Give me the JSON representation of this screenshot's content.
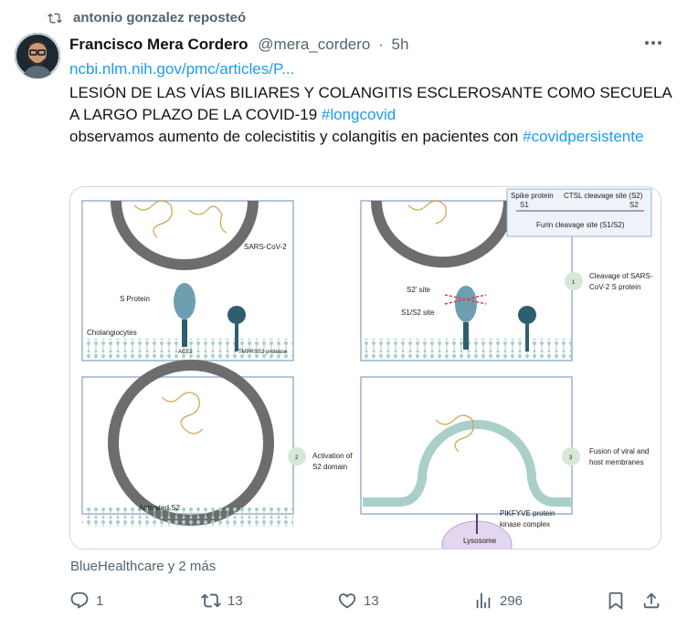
{
  "repost": {
    "icon": "repost-icon",
    "text": "antonio gonzalez reposteó"
  },
  "post": {
    "author_name": "Francisco Mera Cordero",
    "author_handle": "@mera_cordero",
    "separator": "·",
    "time": "5h",
    "link_text": "ncbi.nlm.nih.gov/pmc/articles/P...",
    "line1_text": "LESIÓN DE LAS VÍAS BILIARES Y COLANGITIS ESCLEROSANTE COMO SECUELA A LARGO PLAZO DE LA COVID-19 ",
    "line1_hashtag": "#longcovid",
    "line2_text": "observamos aumento de colecistitis y colangitis en pacientes con ",
    "line2_hashtag": "#covidpersistente"
  },
  "figure": {
    "sars_label": "SARS-CoV-2",
    "s_protein": "S Protein",
    "cholangiocytes": "Cholangiocytes",
    "ace2": "ACE2",
    "tmprss2": "TMPRSS2 protease",
    "spike_box": {
      "spike_protein": "Spike protein",
      "s1": "S1",
      "ctsl": "CTSL cleavage site (S2)",
      "s2": "S2",
      "furin": "Furin cleavage site (S1/S2)"
    },
    "s2_site": "S2' site",
    "s1s2_site": "S1/S2 site",
    "step1_num": "1",
    "step1": "Cleavage of SARS-CoV-2 S protein",
    "step2_num": "2",
    "step2": "Activation of S2 domain",
    "activated_s2": "Activated S2",
    "step3_num": "3",
    "step3": "Fusion of viral and host membranes",
    "pikfyve": "PIKFYVE protein kinase complex",
    "lysosome": "Lysosome"
  },
  "context": "BlueHealthcare y 2 más",
  "actions": {
    "reply": {
      "icon": "reply-icon",
      "count": "1"
    },
    "repost": {
      "icon": "repost-icon",
      "count": "13"
    },
    "like": {
      "icon": "heart-icon",
      "count": "13"
    },
    "views": {
      "icon": "views-icon",
      "count": "296"
    },
    "bookmark": {
      "icon": "bookmark-icon"
    },
    "share": {
      "icon": "share-icon"
    }
  },
  "colors": {
    "accent": "#1d9bf0",
    "muted": "#536471",
    "text": "#0f1419",
    "border": "#cfd9de"
  }
}
